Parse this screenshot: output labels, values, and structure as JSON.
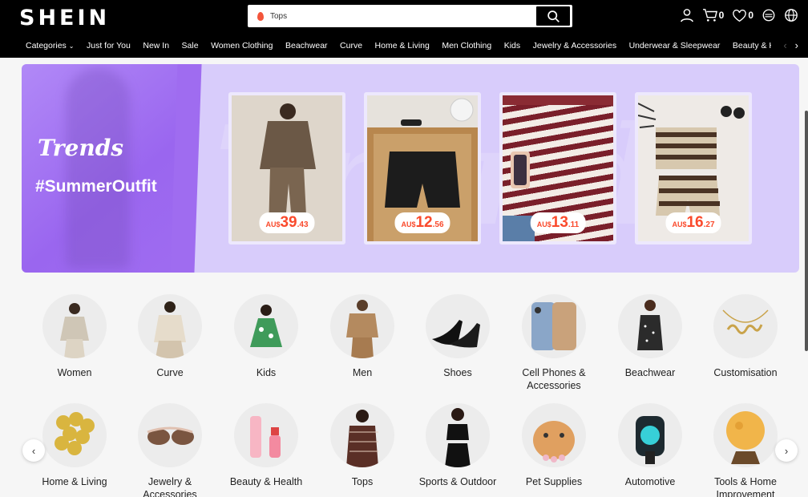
{
  "header": {
    "logo": "SHEIN",
    "search": {
      "value": "Tops"
    },
    "cart_count": "0",
    "wishlist_count": "0"
  },
  "nav": {
    "items": [
      "Categories",
      "Just for You",
      "New In",
      "Sale",
      "Women Clothing",
      "Beachwear",
      "Curve",
      "Home & Living",
      "Men Clothing",
      "Kids",
      "Jewelry & Accessories",
      "Underwear & Sleepwear",
      "Beauty & Hea"
    ]
  },
  "banner": {
    "title": "Trends",
    "hashtag": "#SummerOutfit",
    "products": [
      {
        "currency": "AU$",
        "int": "39",
        "dec": ".43"
      },
      {
        "currency": "AU$",
        "int": "12",
        "dec": ".56"
      },
      {
        "currency": "AU$",
        "int": "13",
        "dec": ".11"
      },
      {
        "currency": "AU$",
        "int": "16",
        "dec": ".27"
      }
    ]
  },
  "categories": {
    "row1": [
      "Women",
      "Curve",
      "Kids",
      "Men",
      "Shoes",
      "Cell Phones & Accessories",
      "Beachwear",
      "Customisation"
    ],
    "row2": [
      "Home & Living",
      "Jewelry & Accessories",
      "Beauty & Health",
      "Tops",
      "Sports & Outdoor",
      "Pet Supplies",
      "Automotive",
      "Tools & Home Improvement"
    ]
  },
  "colors": {
    "accent_price": "#fa4a2c",
    "banner_purple": "#9f6cf0"
  }
}
